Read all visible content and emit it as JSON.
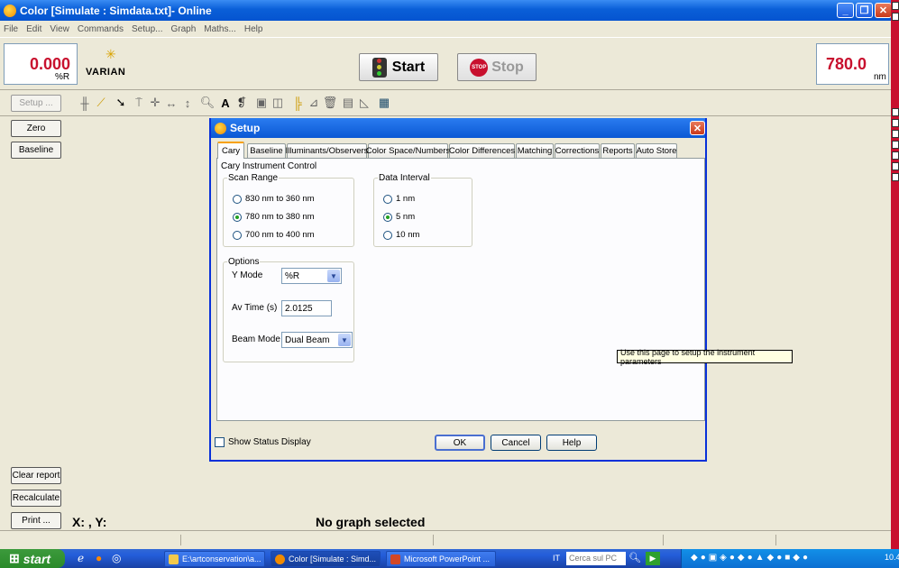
{
  "window": {
    "title": "Color [Simulate : Simdata.txt]- Online"
  },
  "menu": [
    "File",
    "Edit",
    "View",
    "Commands",
    "Setup...",
    "Graph",
    "Maths...",
    "Help"
  ],
  "readout_left": {
    "value": "0.000",
    "unit": "%R"
  },
  "readout_right": {
    "value": "780.0",
    "unit": "nm"
  },
  "brand": "VARIAN",
  "controls": {
    "start": "Start",
    "stop": "Stop",
    "stop_sign_text": "STOP"
  },
  "sidebar": {
    "setup": "Setup ...",
    "zero": "Zero",
    "baseline": "Baseline",
    "clear_report": "Clear report",
    "recalculate": "Recalculate",
    "print": "Print ..."
  },
  "graph": {
    "coords": "X: , Y:",
    "message": "No graph selected"
  },
  "dialog": {
    "title": "Setup",
    "tabs": [
      "Cary",
      "Baseline",
      "Illuminants/Observers",
      "Color Space/Numbers",
      "Color Differences",
      "Matching",
      "Corrections",
      "Reports",
      "Auto Store"
    ],
    "active_tab": "Cary",
    "heading": "Cary Instrument Control",
    "scan_range": {
      "legend": "Scan Range",
      "options": [
        "830 nm to 360 nm",
        "780 nm to 380 nm",
        "700 nm to 400 nm"
      ],
      "selected": 1
    },
    "data_interval": {
      "legend": "Data Interval",
      "options": [
        "1 nm",
        "5 nm",
        "10 nm"
      ],
      "selected": 1
    },
    "options": {
      "legend": "Options",
      "y_mode_label": "Y Mode",
      "y_mode_value": "%R",
      "av_time_label": "Av Time (s)",
      "av_time_value": "2.0125",
      "beam_mode_label": "Beam Mode",
      "beam_mode_value": "Dual Beam"
    },
    "show_status": "Show Status Display",
    "ok": "OK",
    "cancel": "Cancel",
    "help": "Help",
    "tooltip": "Use this page to setup the instrument parameters"
  },
  "taskbar": {
    "start": "start",
    "tasks": [
      "E:\\artconservation\\a...",
      "Color [Simulate : Simd...",
      "Microsoft PowerPoint ..."
    ],
    "lang": "IT",
    "search": "Cerca sul PC",
    "clock": "10.4"
  },
  "colors": {
    "accent": "#0a5fd8",
    "readout": "#c8102e",
    "selected_radio": "#21a121"
  }
}
